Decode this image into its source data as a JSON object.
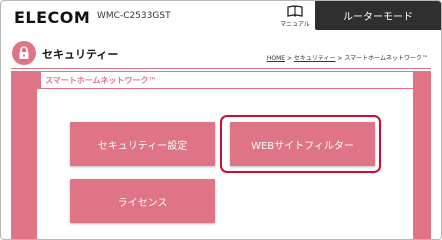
{
  "header": {
    "logo": "ELECOM",
    "model": "WMC-C2533GST",
    "manual_label": "マニュアル",
    "mode_label": "ルーターモード"
  },
  "page": {
    "title": "セキュリティー",
    "breadcrumb": {
      "home": "HOME",
      "sep1": " > ",
      "security": "セキュリティー",
      "sep2": " > ",
      "current": "スマートホームネットワーク™"
    }
  },
  "section": {
    "title": "スマートホームネットワーク™"
  },
  "buttons": {
    "security_settings": "セキュリティー設定",
    "web_filter": "WEBサイトフィルター",
    "license": "ライセンス"
  },
  "colors": {
    "accent": "#de7485",
    "highlight": "#c8102e",
    "mode_tab": "#2f2f2f"
  },
  "icons": {
    "manual": "book-icon",
    "page": "lock-icon"
  }
}
